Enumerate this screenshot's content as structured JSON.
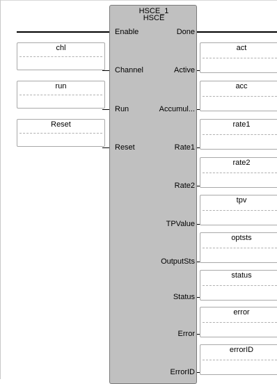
{
  "block": {
    "instance": "HSCE_1",
    "type": "HSCE"
  },
  "inputs": [
    {
      "pin": "Enable",
      "variable": null
    },
    {
      "pin": "Channel",
      "variable": "chl"
    },
    {
      "pin": "Run",
      "variable": "run"
    },
    {
      "pin": "Reset",
      "variable": "Reset"
    }
  ],
  "outputs": [
    {
      "pin": "Done",
      "variable": null
    },
    {
      "pin": "Active",
      "variable": "act"
    },
    {
      "pin": "Accumul...",
      "variable": "acc"
    },
    {
      "pin": "Rate1",
      "variable": "rate1"
    },
    {
      "pin": "Rate2",
      "variable": "rate2"
    },
    {
      "pin": "TPValue",
      "variable": "tpv"
    },
    {
      "pin": "OutputSts",
      "variable": "optsts"
    },
    {
      "pin": "Status",
      "variable": "status"
    },
    {
      "pin": "Error",
      "variable": "error"
    },
    {
      "pin": "ErrorID",
      "variable": "errorID"
    }
  ]
}
